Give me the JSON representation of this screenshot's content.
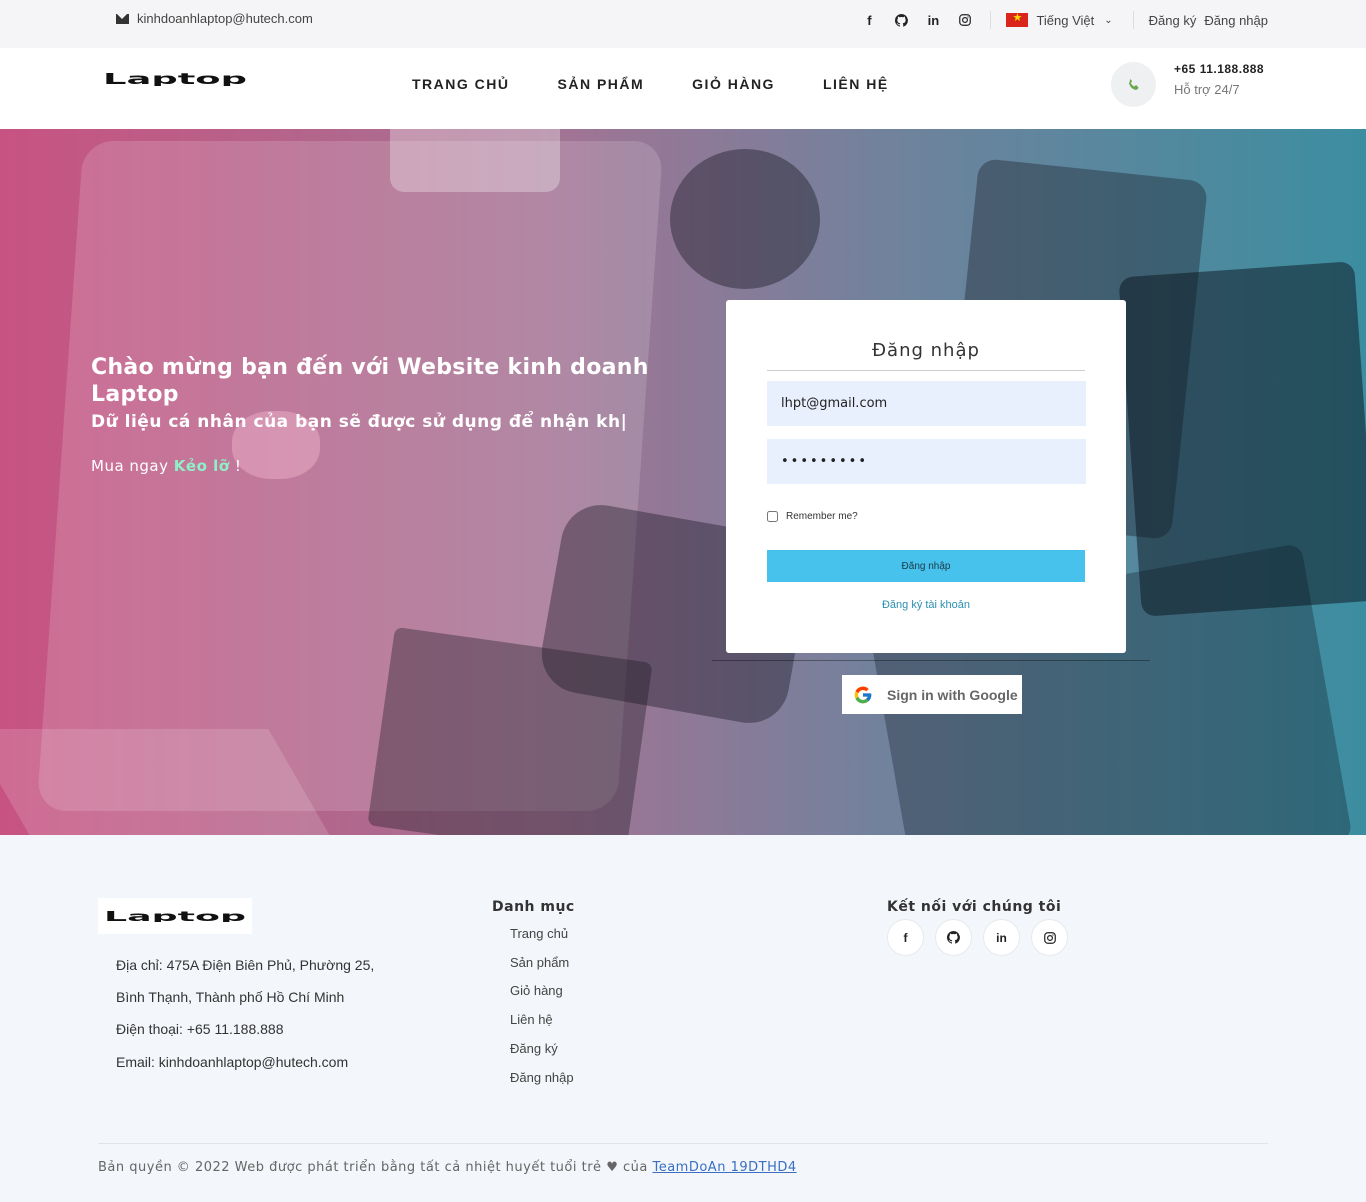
{
  "topbar": {
    "email": "kinhdoanhlaptop@hutech.com",
    "language": "Tiếng Việt",
    "register": "Đăng ký",
    "login": "Đăng nhập"
  },
  "navbar": {
    "logo_text": "Laptop",
    "menu": [
      "TRANG CHỦ",
      "SẢN PHẨM",
      "GIỎ HÀNG",
      "LIÊN HỆ"
    ],
    "phone": "+65 11.188.888",
    "support": "Hỗ trợ 24/7"
  },
  "hero": {
    "title": "Chào mừng bạn đến với Website kinh doanh Laptop",
    "subtitle": "Dữ liệu cá nhân của bạn sẽ được sử dụng để nhận kh|",
    "buy_prefix": "Mua ngay",
    "buy_highlight": "Kẻo lỡ",
    "buy_suffix": "!"
  },
  "login_form": {
    "title": "Đăng nhập",
    "email_value": "lhpt@gmail.com",
    "password_value": "•••••••••",
    "remember_label": "Remember me?",
    "submit_label": "Đăng nhập",
    "register_link": "Đăng ký tài khoản",
    "google_label": "Sign in with Google"
  },
  "footer": {
    "logo_text": "Laptop",
    "address_line1": "Địa chỉ: 475A Điện Biên Phủ, Phường 25,",
    "address_line2": "Bình Thạnh, Thành phố Hồ Chí Minh",
    "phone": "Điện thoại: +65 11.188.888",
    "email": "Email: kinhdoanhlaptop@hutech.com",
    "categories_title": "Danh mục",
    "categories": [
      "Trang chủ",
      "Sản phẩm",
      "Giỏ hàng",
      "Liên hệ",
      "Đăng ký",
      "Đăng nhập"
    ],
    "connect_title": "Kết nối với chúng tôi",
    "copyright_text": "Bản quyền © 2022 Web được phát triển bằng tất cả nhiệt huyết tuổi trẻ",
    "copyright_by": "của",
    "team_link": "TeamDoAn 19DTHD4"
  },
  "colors": {
    "accent": "#46c2ec",
    "link": "#3a6fc4",
    "highlight": "#8ff0c8"
  }
}
